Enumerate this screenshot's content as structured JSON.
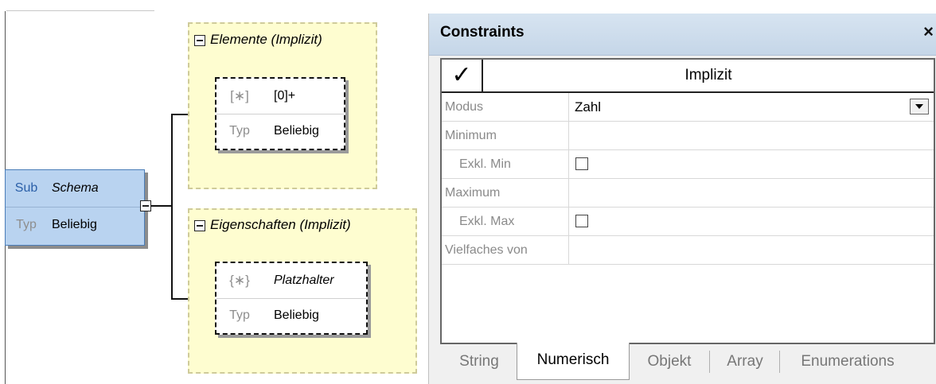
{
  "diagram": {
    "schema_node": {
      "sub_label": "Sub",
      "sub_value": "Schema",
      "type_label": "Typ",
      "type_value": "Beliebig"
    },
    "elements_group": {
      "title": "Elemente (Implizit)",
      "item": {
        "wildcard": "[∗]",
        "cardinality": "[0]+",
        "type_label": "Typ",
        "type_value": "Beliebig"
      }
    },
    "properties_group": {
      "title": "Eigenschaften (Implizit)",
      "item": {
        "wildcard": "{∗}",
        "name": "Platzhalter",
        "type_label": "Typ",
        "type_value": "Beliebig"
      }
    }
  },
  "panel": {
    "title": "Constraints",
    "close": "×",
    "header_check": "✓",
    "header_title": "Implizit",
    "rows": [
      {
        "label": "Modus",
        "value": "Zahl"
      },
      {
        "label": "Minimum",
        "value": ""
      },
      {
        "label": "Exkl. Min",
        "value": ""
      },
      {
        "label": "Maximum",
        "value": ""
      },
      {
        "label": "Exkl. Max",
        "value": ""
      },
      {
        "label": "Vielfaches von",
        "value": ""
      }
    ],
    "tabs": [
      "String",
      "Numerisch",
      "Objekt",
      "Array",
      "Enumerations"
    ],
    "active_tab": "Numerisch"
  }
}
